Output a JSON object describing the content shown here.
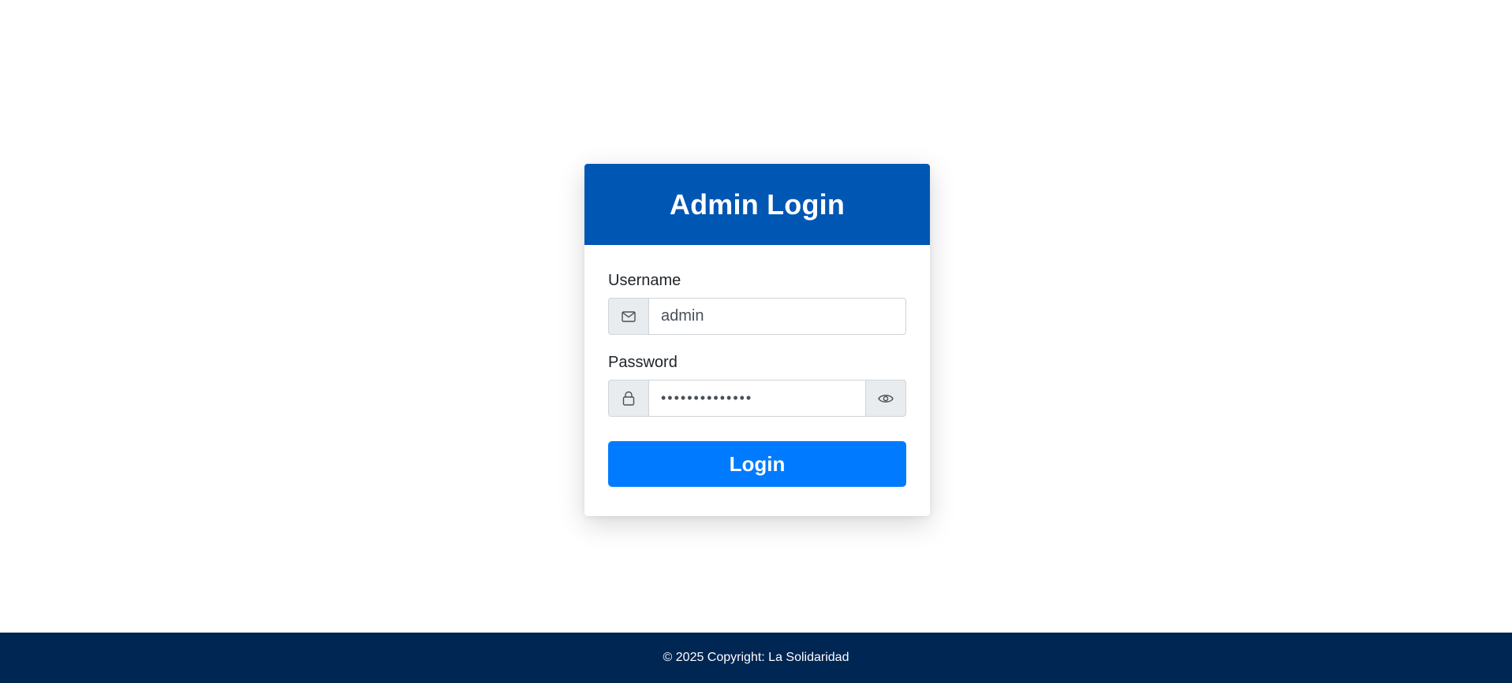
{
  "login_card": {
    "title": "Admin Login",
    "username": {
      "label": "Username",
      "value": "admin",
      "icon": "envelope-icon"
    },
    "password": {
      "label": "Password",
      "value": "••••••••••••••",
      "icon": "lock-icon",
      "toggle_icon": "eye-icon"
    },
    "login_label": "Login"
  },
  "footer": {
    "copyright": "© 2025 Copyright: La Solidaridad"
  },
  "colors": {
    "header": "#0056b3",
    "button": "#007bff",
    "footer": "#002654"
  }
}
